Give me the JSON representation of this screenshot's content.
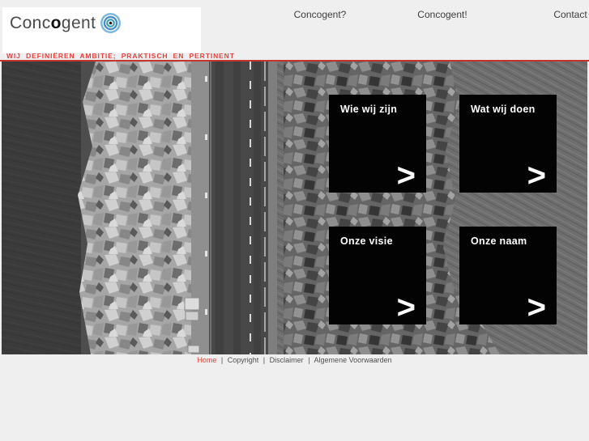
{
  "header": {
    "logo": {
      "prefix": "Conc",
      "bold": "o",
      "suffix": "gent"
    },
    "nav": [
      {
        "label": "Concogent?"
      },
      {
        "label": "Concogent!"
      },
      {
        "label": "Contact"
      }
    ],
    "tagline": "WIJ DEFINIËREN AMBITIE; PRAKTISCH EN PERTINENT"
  },
  "hero": {
    "description": "black-and-white aerial photo of a dike road between rock revetments and water",
    "tiles": [
      {
        "label": "Wie wij zijn",
        "arrow": ">"
      },
      {
        "label": "Wat wij doen",
        "arrow": ">"
      },
      {
        "label": "Onze visie",
        "arrow": ">"
      },
      {
        "label": "Onze naam",
        "arrow": ">"
      }
    ]
  },
  "footer": {
    "separator": "|",
    "links": [
      {
        "label": "Home",
        "active": true
      },
      {
        "label": "Copyright",
        "active": false
      },
      {
        "label": "Disclaimer",
        "active": false
      },
      {
        "label": "Algemene Voorwaarden",
        "active": false
      }
    ]
  },
  "colors": {
    "accent_red": "#e8413c",
    "divider_red": "#c2362f",
    "tile_bg": "#030303",
    "tile_text": "#ffffff",
    "page_bg": "#efefef"
  }
}
